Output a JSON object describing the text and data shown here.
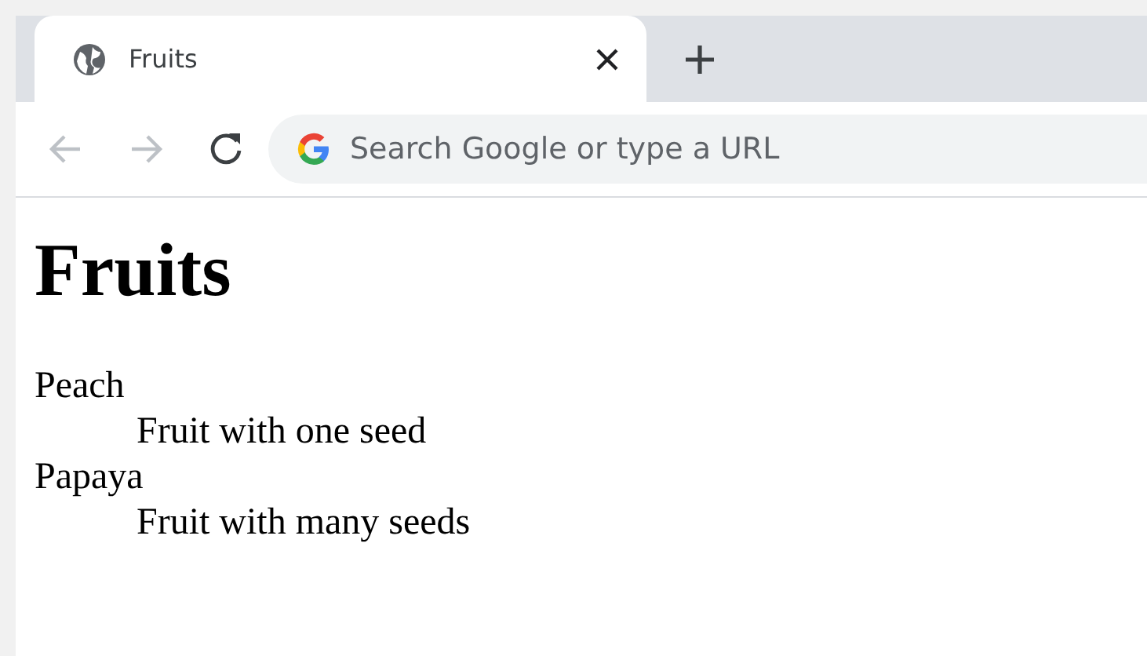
{
  "tabs": [
    {
      "title": "Fruits",
      "selected": true
    }
  ],
  "omnibox": {
    "placeholder": "Search Google or type a URL"
  },
  "page": {
    "heading": "Fruits",
    "definitions": [
      {
        "term": "Peach",
        "description": "Fruit with one seed"
      },
      {
        "term": "Papaya",
        "description": "Fruit with many seeds"
      }
    ]
  }
}
